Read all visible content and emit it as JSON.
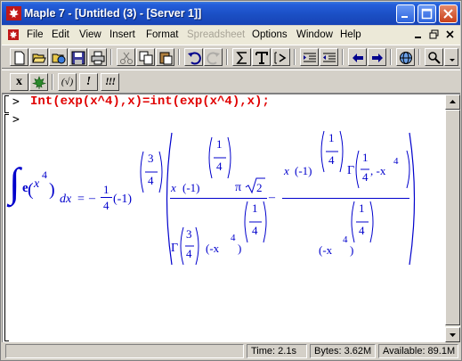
{
  "window": {
    "title": "Maple 7  - [Untitled (3) - [Server 1]]"
  },
  "menu": {
    "items": [
      {
        "label": "File"
      },
      {
        "label": "Edit"
      },
      {
        "label": "View"
      },
      {
        "label": "Insert"
      },
      {
        "label": "Format"
      },
      {
        "label": "Spreadsheet",
        "disabled": true
      },
      {
        "label": "Options"
      },
      {
        "label": "Window"
      },
      {
        "label": "Help"
      }
    ]
  },
  "toolbar": {
    "buttons": [
      "new-icon",
      "open-icon",
      "open-url-icon",
      "save-icon",
      "print-icon",
      "cut-icon",
      "copy-icon",
      "paste-icon",
      "undo-icon",
      "redo-icon",
      "sum-icon",
      "text-icon",
      "prompt-icon",
      "indent-icon",
      "outdent-icon",
      "back-icon",
      "forward-icon",
      "globe-icon",
      "zoom-icon",
      "menu-arrow-icon"
    ]
  },
  "toolbar2": {
    "x_label": "x",
    "paren_label": "(√)",
    "exclaim_label": "!",
    "triple_label": "!!!"
  },
  "worksheet": {
    "prompt1": ">",
    "prompt2": ">",
    "input_command": "Int(exp(x^4),x)=int(exp(x^4),x);"
  },
  "output": {
    "integral": "∫",
    "e": "e",
    "x": "x",
    "exp4": "4",
    "dx": "dx",
    "equals": "=",
    "minus": "–",
    "one": "1",
    "four": "4",
    "neg1": "(-1)",
    "three": "3",
    "t1_x": "x",
    "t1_neg1": "(-1)",
    "t1_pi": "π",
    "t1_root": "2",
    "gamma": "Γ",
    "neg_x": "(-x",
    "close": ")",
    "minus2": "–",
    "t2_x": "x",
    "t2_neg1": "(-1)",
    "t2_gamma_arg": ", -x",
    "t2_den": "(-x"
  },
  "status": {
    "time": "Time:  2.1s",
    "bytes": "Bytes: 3.62M",
    "available": "Available: 89.1M"
  },
  "colors": {
    "titlebar": "#1b4fc4",
    "input": "#e00000",
    "output": "#0000cc"
  }
}
